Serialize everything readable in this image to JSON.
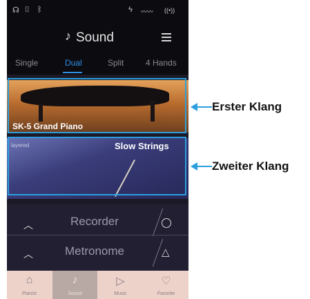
{
  "status_bar": {
    "icons": [
      "headphones-icon",
      "usb-icon",
      "bluetooth-icon",
      "usb-charge-icon",
      "waveform-icon",
      "wireless-icon"
    ]
  },
  "header": {
    "title": "Sound",
    "title_icon": "music-note-icon",
    "menu_icon": "list-menu-icon"
  },
  "tabs": [
    {
      "label": "Single",
      "active": false
    },
    {
      "label": "Dual",
      "active": true
    },
    {
      "label": "Split",
      "active": false
    },
    {
      "label": "4 Hands",
      "active": false
    }
  ],
  "sounds": {
    "first": {
      "name": "SK-5 Grand Piano"
    },
    "second": {
      "tag": "layered",
      "name": "Slow Strings"
    }
  },
  "panel": {
    "recorder_label": "Recorder",
    "metronome_label": "Metronome"
  },
  "nav": [
    {
      "label": "Pianist",
      "icon": "piano-icon",
      "active": false
    },
    {
      "label": "Sound",
      "icon": "music-note-icon",
      "active": true
    },
    {
      "label": "Music",
      "icon": "play-icon",
      "active": false
    },
    {
      "label": "Favorite",
      "icon": "heart-icon",
      "active": false
    }
  ],
  "callouts": {
    "first": "Erster Klang",
    "second": "Zweiter Klang"
  },
  "colors": {
    "accent": "#2e8fe6",
    "highlight": "#2b9fe0"
  }
}
